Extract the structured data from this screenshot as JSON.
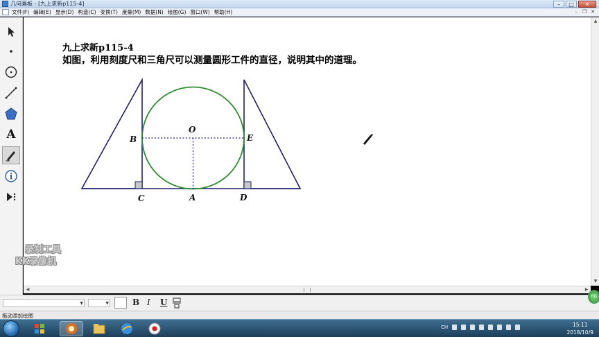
{
  "window": {
    "title": "几何画板 - [九上求新p115-4]",
    "min_label": "–",
    "max_label": "□",
    "close_label": "✕"
  },
  "menubar": {
    "items": [
      "文件(F)",
      "编辑(E)",
      "显示(D)",
      "构造(C)",
      "变换(T)",
      "度量(M)",
      "数据(N)",
      "绘图(G)",
      "窗口(W)",
      "帮助(H)"
    ]
  },
  "toolbox": {
    "tools": [
      {
        "name": "arrow-tool-icon"
      },
      {
        "name": "point-tool-icon"
      },
      {
        "name": "compass-tool-icon"
      },
      {
        "name": "straightedge-tool-icon"
      },
      {
        "name": "polygon-tool-icon"
      },
      {
        "name": "text-tool-icon",
        "label": "A"
      },
      {
        "name": "marker-tool-icon",
        "active": true
      },
      {
        "name": "information-tool-icon",
        "label": "i"
      },
      {
        "name": "custom-tool-icon"
      }
    ]
  },
  "document": {
    "heading": "九上求新p115-4",
    "problem": "如图，利用刻度尺和三角尺可以测量圆形工件的直径，说明其中的道理。",
    "labels": {
      "O": "O",
      "B": "B",
      "E": "E",
      "C": "C",
      "A": "A",
      "D": "D"
    },
    "colors": {
      "circle": "#2e8b2e",
      "lines": "#1f1f6e",
      "dotted": "#1f1f6e",
      "right_angle_fill": "#c8c8c8"
    }
  },
  "watermark": {
    "line1": "录制工具",
    "line2": "KK录像机"
  },
  "formatbar": {
    "bold": "B",
    "italic": "I",
    "underline": "U"
  },
  "statusbar": {
    "text": "拖动添加绘图"
  },
  "taskbar": {
    "apps": [
      "start-orb",
      "media-app-icon",
      "geometry-sketchpad-icon",
      "file-explorer-icon",
      "browser-icon",
      "recorder-icon"
    ],
    "tray_lang": "CH",
    "time": "15:11",
    "date": "2018/10/9"
  }
}
